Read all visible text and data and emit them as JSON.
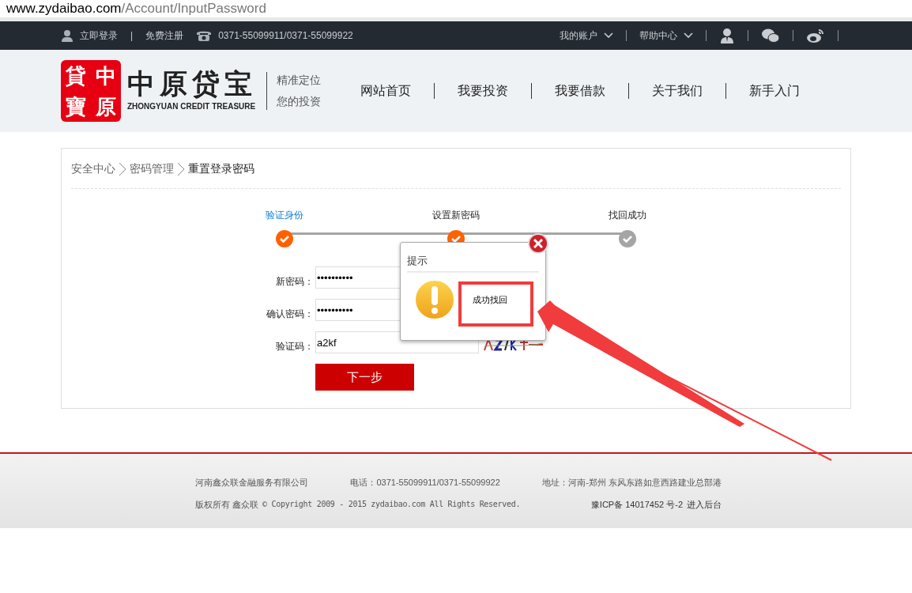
{
  "address_bar": {
    "url_host": "www.zydaibao.com",
    "url_path": "/Account/InputPassword"
  },
  "top_bar": {
    "login": "立即登录",
    "separator": "|",
    "register": "免费注册",
    "phone": "0371-55099911/0371-55099922",
    "menus": [
      "我的账户",
      "帮助中心"
    ]
  },
  "header": {
    "logo_seal": [
      "貸",
      "中",
      "寶",
      "原"
    ],
    "logo_title": "中原贷宝",
    "logo_subtitle": "ZHONGYUAN CREDIT TREASURE",
    "slogan": [
      "精准定位",
      "您的投资"
    ],
    "nav": [
      "网站首页",
      "我要投资",
      "我要借款",
      "关于我们",
      "新手入门"
    ]
  },
  "breadcrumb": [
    "安全中心",
    "密码管理",
    "重置登录密码"
  ],
  "steps": [
    {
      "label": "验证身份",
      "done": true,
      "selected": true
    },
    {
      "label": "设置新密码",
      "done": true,
      "selected": false
    },
    {
      "label": "找回成功",
      "done": false,
      "selected": false
    }
  ],
  "form": {
    "fields": [
      {
        "label": "新密码：",
        "value": "••••••••••"
      },
      {
        "label": "确认密码：",
        "value": "••••••••••"
      },
      {
        "label": "验证码：",
        "value": "a2kf"
      }
    ],
    "submit": "下一步"
  },
  "dialog": {
    "title": "提示",
    "message": "成功找回"
  },
  "footer": {
    "lines": [
      [
        "河南鑫众联金融服务有限公司",
        "电话：0371-55099911/0371-55099922",
        "地址：河南-郑州 东风东路如意西路建业总部港"
      ],
      [
        "版权所有 鑫众联",
        "© Copyright 2009 - 2015 zydaibao.com All Rights Reserved.",
        "豫ICP备 14017452 号-2",
        "进入后台"
      ]
    ]
  }
}
